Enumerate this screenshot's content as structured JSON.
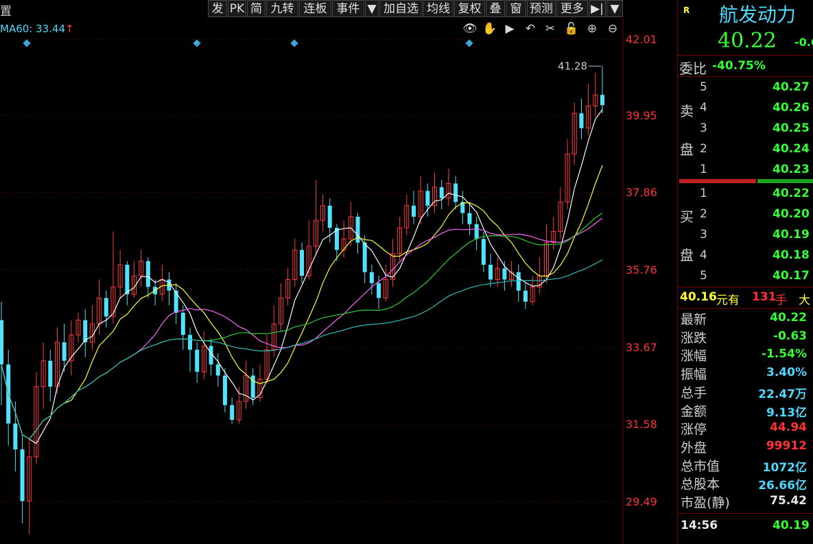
{
  "toolbar": {
    "left_label": "置",
    "buttons": [
      "发",
      "PK",
      "简",
      "九转",
      "连板",
      "事件",
      "▼",
      "加自选",
      "均线",
      "复权",
      "叠",
      "窗",
      "预测",
      "更多",
      "▶|",
      "▼"
    ]
  },
  "ma_label": "MA60: 33.44",
  "ma_arrow": "↑",
  "tool_icons": [
    "eye-icon",
    "hand-icon",
    "play-circle-icon",
    "undo-icon",
    "scissors-icon",
    "lock-icon",
    "zoom-in-icon",
    "zoom-out-icon"
  ],
  "tool_glyphs": [
    "👁",
    "✋",
    "▶",
    "↶",
    "✂",
    "🔓",
    "⊕",
    "⊖"
  ],
  "price_axis": [
    "42.01",
    "39.95",
    "37.86",
    "35.76",
    "33.67",
    "31.58",
    "29.49"
  ],
  "high_label": "41.28",
  "colors": {
    "up": "#ff3b3b",
    "down": "#4fe3ff",
    "ma5": "#ffffff",
    "ma10": "#ffff33",
    "ma20": "#ff66ff",
    "ma30": "#33cc33",
    "ma60": "#33bbbb",
    "grid": "#7a0000",
    "green_text": "#33ff33",
    "red_text": "#ff3333",
    "cyan_text": "#4fd9ff",
    "yellow_text": "#ffff33"
  },
  "quote": {
    "flag": "R",
    "name": "航发动力",
    "price": "40.22",
    "change_partial": "-0.6",
    "weibi_label": "委比",
    "weibi_value": "-40.75%",
    "sell_label_1": "卖",
    "sell_label_2": "盘",
    "buy_label_1": "买",
    "buy_label_2": "盘",
    "sell": [
      {
        "level": "5",
        "price": "40.27"
      },
      {
        "level": "4",
        "price": "40.26"
      },
      {
        "level": "3",
        "price": "40.25"
      },
      {
        "level": "2",
        "price": "40.24"
      },
      {
        "level": "1",
        "price": "40.23"
      }
    ],
    "buy": [
      {
        "level": "1",
        "price": "40.22"
      },
      {
        "level": "2",
        "price": "40.20"
      },
      {
        "level": "3",
        "price": "40.19"
      },
      {
        "level": "4",
        "price": "40.18"
      },
      {
        "level": "5",
        "price": "40.17"
      }
    ],
    "big_order_price": "40.16",
    "big_order_text1": "元有",
    "big_order_qty": "131",
    "big_order_text2": "手",
    "big_order_text3": "大",
    "stats": [
      {
        "label": "最新",
        "value": "40.22",
        "color": "green"
      },
      {
        "label": "涨跌",
        "value": "-0.63",
        "color": "green"
      },
      {
        "label": "涨幅",
        "value": "-1.54%",
        "color": "green"
      },
      {
        "label": "振幅",
        "value": "3.40%",
        "color": "cyan"
      },
      {
        "label": "总手",
        "value": "22.47万",
        "color": "cyan"
      },
      {
        "label": "金额",
        "value": "9.13亿",
        "color": "cyan"
      },
      {
        "label": "涨停",
        "value": "44.94",
        "color": "red"
      },
      {
        "label": "外盘",
        "value": "99912",
        "color": "red"
      },
      {
        "label": "总市值",
        "value": "1072亿",
        "color": "cyan"
      },
      {
        "label": "总股本",
        "value": "26.66亿",
        "color": "cyan"
      },
      {
        "label": "市盈(静)",
        "value": "75.42",
        "color": "white"
      }
    ],
    "tick_time": "14:56",
    "tick_price": "40.19"
  },
  "chart_data": {
    "type": "candlestick",
    "ylim": [
      29.49,
      42.01
    ],
    "grid": true,
    "candles": [
      [
        34.4,
        33.2,
        34.9,
        32.1
      ],
      [
        33.2,
        31.6,
        33.6,
        31.0
      ],
      [
        31.6,
        30.9,
        32.2,
        30.3
      ],
      [
        30.9,
        29.5,
        31.3,
        28.9
      ],
      [
        29.5,
        30.7,
        31.2,
        28.6
      ],
      [
        30.7,
        32.6,
        33.0,
        30.5
      ],
      [
        32.6,
        33.3,
        33.8,
        32.0
      ],
      [
        33.3,
        32.6,
        33.6,
        32.2
      ],
      [
        32.6,
        33.8,
        34.2,
        32.4
      ],
      [
        33.8,
        33.3,
        34.3,
        33.0
      ],
      [
        33.3,
        34.0,
        34.4,
        32.9
      ],
      [
        34.0,
        34.4,
        34.6,
        33.8
      ],
      [
        34.4,
        33.8,
        34.7,
        33.4
      ],
      [
        33.8,
        34.3,
        34.8,
        33.6
      ],
      [
        34.3,
        35.0,
        35.5,
        34.0
      ],
      [
        35.0,
        34.5,
        35.2,
        34.2
      ],
      [
        34.5,
        35.3,
        36.8,
        34.3
      ],
      [
        35.3,
        35.9,
        36.3,
        35.0
      ],
      [
        35.9,
        35.1,
        36.0,
        34.8
      ],
      [
        35.1,
        35.6,
        36.0,
        35.0
      ],
      [
        35.6,
        36.0,
        36.3,
        35.3
      ],
      [
        36.0,
        35.3,
        36.1,
        35.0
      ],
      [
        35.3,
        35.1,
        35.5,
        34.8
      ],
      [
        35.1,
        35.5,
        35.9,
        34.9
      ],
      [
        35.5,
        35.2,
        35.7,
        34.8
      ],
      [
        35.2,
        34.6,
        35.4,
        34.3
      ],
      [
        34.6,
        34.0,
        34.8,
        33.6
      ],
      [
        34.0,
        33.6,
        34.2,
        33.0
      ],
      [
        33.6,
        33.0,
        33.8,
        32.7
      ],
      [
        33.0,
        33.7,
        34.1,
        32.8
      ],
      [
        33.7,
        33.2,
        33.9,
        32.9
      ],
      [
        33.2,
        32.9,
        33.5,
        32.6
      ],
      [
        32.9,
        32.1,
        33.1,
        31.9
      ],
      [
        32.1,
        31.7,
        32.3,
        31.6
      ],
      [
        31.7,
        32.2,
        32.6,
        31.6
      ],
      [
        32.2,
        32.9,
        33.3,
        32.0
      ],
      [
        32.9,
        32.3,
        33.1,
        32.1
      ],
      [
        32.3,
        32.8,
        33.2,
        32.2
      ],
      [
        32.8,
        33.6,
        34.0,
        32.7
      ],
      [
        33.6,
        34.3,
        34.8,
        33.4
      ],
      [
        34.3,
        35.0,
        35.4,
        34.1
      ],
      [
        35.0,
        35.5,
        35.8,
        34.8
      ],
      [
        35.5,
        36.3,
        36.6,
        35.3
      ],
      [
        36.3,
        35.6,
        36.5,
        35.4
      ],
      [
        35.6,
        36.4,
        37.1,
        35.5
      ],
      [
        36.4,
        37.1,
        38.2,
        36.2
      ],
      [
        37.1,
        37.5,
        37.8,
        36.8
      ],
      [
        37.5,
        36.9,
        37.7,
        36.5
      ],
      [
        36.9,
        36.3,
        37.0,
        36.0
      ],
      [
        36.3,
        36.6,
        37.1,
        36.1
      ],
      [
        36.6,
        37.2,
        37.6,
        36.4
      ],
      [
        37.2,
        36.5,
        37.3,
        36.2
      ],
      [
        36.5,
        35.7,
        36.7,
        35.4
      ],
      [
        35.7,
        35.4,
        35.9,
        35.1
      ],
      [
        35.4,
        35.0,
        35.6,
        34.7
      ],
      [
        35.0,
        35.5,
        35.9,
        34.9
      ],
      [
        35.5,
        36.2,
        36.6,
        35.3
      ],
      [
        36.2,
        36.9,
        37.2,
        36.0
      ],
      [
        36.9,
        37.5,
        37.8,
        36.7
      ],
      [
        37.5,
        37.2,
        37.9,
        37.0
      ],
      [
        37.2,
        37.9,
        38.3,
        37.0
      ],
      [
        37.9,
        37.5,
        38.1,
        37.2
      ],
      [
        37.5,
        38.0,
        38.4,
        37.3
      ],
      [
        38.0,
        37.7,
        38.2,
        37.4
      ],
      [
        37.7,
        38.1,
        38.5,
        37.5
      ],
      [
        38.1,
        37.6,
        38.3,
        37.4
      ],
      [
        37.6,
        37.3,
        37.9,
        37.0
      ],
      [
        37.3,
        37.0,
        37.6,
        36.7
      ],
      [
        37.0,
        36.6,
        37.2,
        36.3
      ],
      [
        36.6,
        35.9,
        36.8,
        35.7
      ],
      [
        35.9,
        35.5,
        36.2,
        35.3
      ],
      [
        35.5,
        35.8,
        36.1,
        35.3
      ],
      [
        35.8,
        35.5,
        36.0,
        35.2
      ],
      [
        35.5,
        35.7,
        36.0,
        35.3
      ],
      [
        35.7,
        35.2,
        35.9,
        34.9
      ],
      [
        35.2,
        34.9,
        35.4,
        34.7
      ],
      [
        34.9,
        35.3,
        35.6,
        34.8
      ],
      [
        35.3,
        35.6,
        36.1,
        35.1
      ],
      [
        35.6,
        36.5,
        37.0,
        35.4
      ],
      [
        36.5,
        36.8,
        37.2,
        36.3
      ],
      [
        36.8,
        37.6,
        38.0,
        36.6
      ],
      [
        37.6,
        38.9,
        39.3,
        37.4
      ],
      [
        38.9,
        40.0,
        40.3,
        38.6
      ],
      [
        40.0,
        39.6,
        40.4,
        39.3
      ],
      [
        39.6,
        40.2,
        40.8,
        39.4
      ],
      [
        40.2,
        40.5,
        41.1,
        39.9
      ],
      [
        40.5,
        40.22,
        41.28,
        40.0
      ]
    ]
  }
}
